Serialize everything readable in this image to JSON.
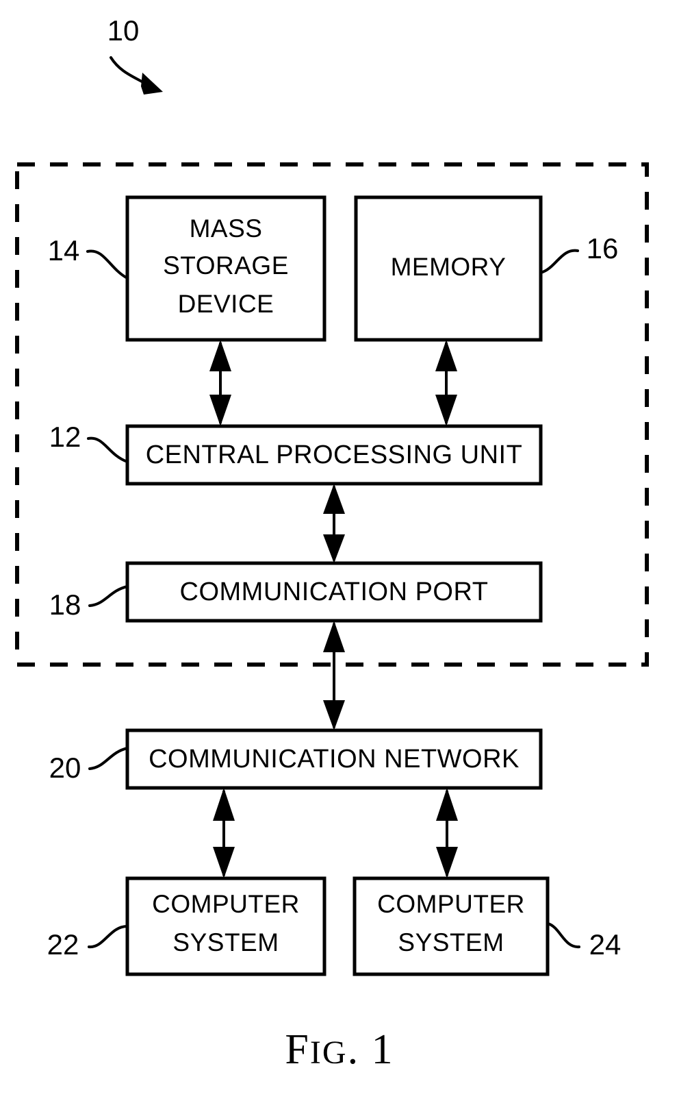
{
  "figure": {
    "caption_prefix": "F",
    "caption_mid": "IG",
    "caption_suffix": ". 1",
    "caption_full": "FIG. 1"
  },
  "enclosure": {
    "ref": "10",
    "name": "computer-system-boundary"
  },
  "blocks": [
    {
      "id": "mass-storage-device",
      "ref": "14",
      "lines": [
        "MASS",
        "STORAGE",
        "DEVICE"
      ],
      "label": "MASS STORAGE DEVICE",
      "ref_side": "left"
    },
    {
      "id": "memory",
      "ref": "16",
      "lines": [
        "MEMORY"
      ],
      "label": "MEMORY",
      "ref_side": "right"
    },
    {
      "id": "central-processing-unit",
      "ref": "12",
      "lines": [
        "CENTRAL PROCESSING UNIT"
      ],
      "label": "CENTRAL PROCESSING UNIT",
      "ref_side": "left"
    },
    {
      "id": "communication-port",
      "ref": "18",
      "lines": [
        "COMMUNICATION PORT"
      ],
      "label": "COMMUNICATION PORT",
      "ref_side": "left"
    },
    {
      "id": "communication-network",
      "ref": "20",
      "lines": [
        "COMMUNICATION NETWORK"
      ],
      "label": "COMMUNICATION NETWORK",
      "ref_side": "left"
    },
    {
      "id": "computer-system-left",
      "ref": "22",
      "lines": [
        "COMPUTER",
        "SYSTEM"
      ],
      "label": "COMPUTER SYSTEM",
      "ref_side": "left"
    },
    {
      "id": "computer-system-right",
      "ref": "24",
      "lines": [
        "COMPUTER",
        "SYSTEM"
      ],
      "label": "COMPUTER SYSTEM",
      "ref_side": "right"
    }
  ],
  "text": {
    "mass_l1": "MASS",
    "mass_l2": "STORAGE",
    "mass_l3": "DEVICE",
    "memory": "MEMORY",
    "cpu": "CENTRAL PROCESSING UNIT",
    "comm_port": "COMMUNICATION PORT",
    "comm_network": "COMMUNICATION NETWORK",
    "cs_left_l1": "COMPUTER",
    "cs_left_l2": "SYSTEM",
    "cs_right_l1": "COMPUTER",
    "cs_right_l2": "SYSTEM"
  },
  "refs": {
    "system": "10",
    "cpu": "12",
    "mass_storage": "14",
    "memory": "16",
    "comm_port": "18",
    "comm_network": "20",
    "cs_left": "22",
    "cs_right": "24"
  },
  "connections": [
    {
      "id": "mass-storage-to-cpu",
      "from": "mass-storage-device",
      "to": "central-processing-unit",
      "style": "double-arrow"
    },
    {
      "id": "memory-to-cpu",
      "from": "memory",
      "to": "central-processing-unit",
      "style": "double-arrow"
    },
    {
      "id": "cpu-to-comm-port",
      "from": "central-processing-unit",
      "to": "communication-port",
      "style": "double-arrow"
    },
    {
      "id": "comm-port-to-network",
      "from": "communication-port",
      "to": "communication-network",
      "style": "double-arrow"
    },
    {
      "id": "network-to-cs-left",
      "from": "communication-network",
      "to": "computer-system-left",
      "style": "double-arrow"
    },
    {
      "id": "network-to-cs-right",
      "from": "communication-network",
      "to": "computer-system-right",
      "style": "double-arrow"
    }
  ],
  "colors": {
    "ink": "#000000",
    "paper": "#ffffff"
  }
}
